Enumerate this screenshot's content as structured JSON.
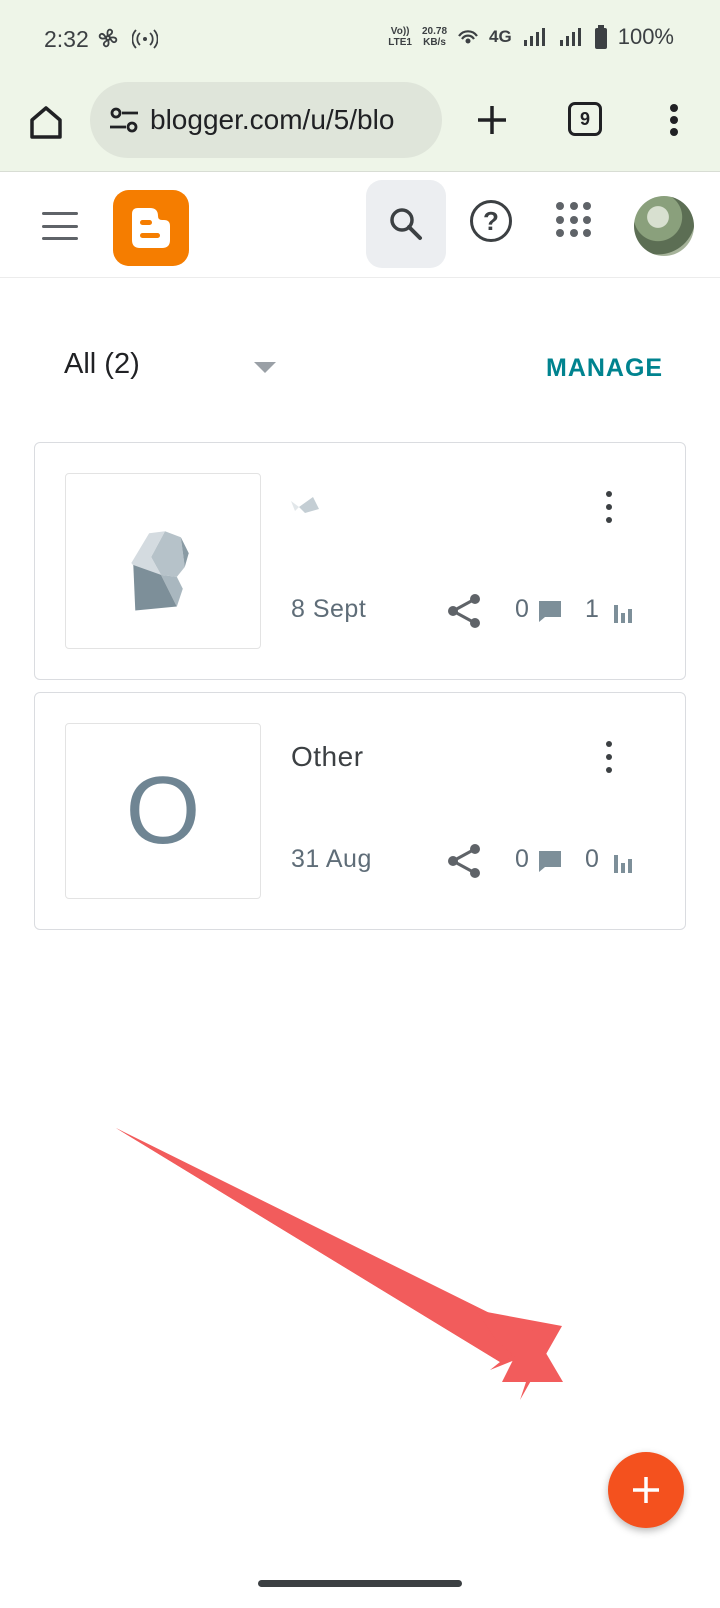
{
  "status_bar": {
    "time": "2:32",
    "volte_top": "Vo))",
    "volte_bottom": "LTE1",
    "speed_top": "20.78",
    "speed_bottom": "KB/s",
    "network": "4G",
    "battery": "100%",
    "icons": [
      "fan-icon",
      "hotspot-icon",
      "wifi-calling-icon",
      "signal-icon",
      "signal-icon",
      "battery-icon"
    ]
  },
  "browser": {
    "url": "blogger.com/u/5/blo",
    "tab_count": "9",
    "icons": [
      "home-icon",
      "tune-icon",
      "plus-icon",
      "overflow-menu-icon"
    ]
  },
  "app_bar": {
    "logo": "blogger-logo",
    "icons": [
      "menu-icon",
      "search-icon",
      "help-icon",
      "apps-grid-icon",
      "avatar"
    ],
    "help_glyph": "?"
  },
  "filter": {
    "label": "All (2)",
    "action": "MANAGE"
  },
  "posts": [
    {
      "title": "",
      "date": "8 Sept",
      "comments": "0",
      "views": "1",
      "thumbnail": "image"
    },
    {
      "title": "Other",
      "date": "31 Aug",
      "comments": "0",
      "views": "0",
      "thumbnail_letter": "O"
    }
  ],
  "colors": {
    "brand": "#f57d00",
    "manage": "#00838f",
    "fab": "#f4511e",
    "arrow": "#f25c5c",
    "browser_bg": "#eef5e8"
  },
  "fab": {
    "icon": "plus-icon"
  }
}
